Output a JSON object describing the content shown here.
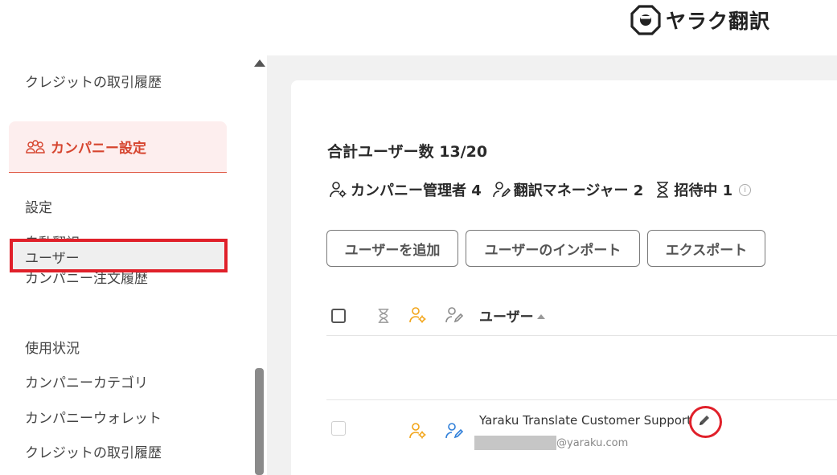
{
  "header": {
    "logo_text": "ヤラク翻訳"
  },
  "sidebar": {
    "top_item": "クレジットの取引履歴",
    "company_settings": "カンパニー設定",
    "items": [
      "設定",
      "自動翻訳",
      "カンパニー注文履歴",
      "ユーザー",
      "使用状況",
      "カンパニーカテゴリ",
      "カンパニーウォレット",
      "クレジットの取引履歴"
    ],
    "selected_index": 3
  },
  "main": {
    "total_users": "合計ユーザー数 13/20",
    "stats": {
      "company_admin": "カンパニー管理者 4",
      "translation_manager": "翻訳マネージャー 2",
      "inviting": "招待中 1"
    },
    "buttons": {
      "add_user": "ユーザーを追加",
      "import_users": "ユーザーのインポート",
      "export": "エクスポート"
    },
    "table": {
      "user_column": "ユーザー",
      "rows": [
        {
          "name": "Yaraku Translate Customer Support",
          "email": "@yaraku.com"
        }
      ]
    }
  },
  "colors": {
    "accent": "#d6452f",
    "admin_icon": "#f2a417",
    "manager_icon": "#2f7fd9",
    "highlight": "#e0202a"
  }
}
